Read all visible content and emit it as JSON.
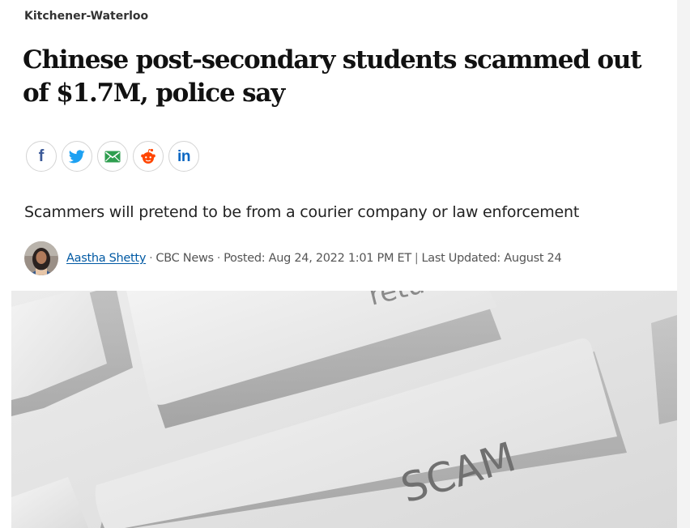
{
  "article": {
    "section": "Kitchener-Waterloo",
    "headline": "Chinese post-secondary students scammed out of $1.7M, police say",
    "deck": "Scammers will pretend to be from a courier company or law enforcement"
  },
  "share": {
    "buttons": [
      {
        "name": "facebook",
        "icon": "facebook-icon",
        "color": "#3b5998"
      },
      {
        "name": "twitter",
        "icon": "twitter-icon",
        "color": "#1da1f2"
      },
      {
        "name": "email",
        "icon": "email-icon",
        "color": "#2e9e4f"
      },
      {
        "name": "reddit",
        "icon": "reddit-icon",
        "color": "#ff4500"
      },
      {
        "name": "linkedin",
        "icon": "linkedin-icon",
        "color": "#0a66c2"
      }
    ],
    "facebook_glyph": "f",
    "linkedin_glyph": "in"
  },
  "byline": {
    "author": "Aastha Shetty",
    "outlet": "CBC News",
    "separator": "·",
    "posted": "Posted: Aug 24, 2022 1:01 PM ET",
    "divider": "|",
    "updated": "Last Updated: August 24"
  },
  "hero_image": {
    "key_top_text": "retu",
    "key_main_text": "SCAM"
  }
}
